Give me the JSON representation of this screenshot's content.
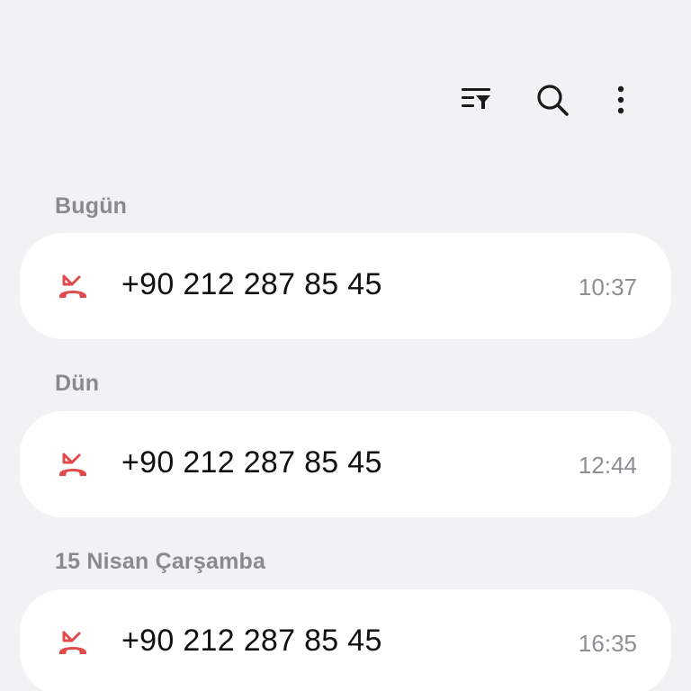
{
  "toolbar": {
    "filter_icon": "filter-list-icon",
    "search_icon": "search-icon",
    "more_icon": "more-vertical-icon"
  },
  "colors": {
    "missed": "#e04a4a",
    "background": "#f2f2f4",
    "card": "#ffffff",
    "header_text": "#8a8a8e",
    "time_text": "#8e8e93"
  },
  "groups": [
    {
      "header": "Bugün",
      "calls": [
        {
          "number": "+90 212 287 85 45",
          "time": "10:37",
          "type": "missed",
          "icon": "missed-call-icon"
        }
      ]
    },
    {
      "header": "Dün",
      "calls": [
        {
          "number": "+90 212 287 85 45",
          "time": "12:44",
          "type": "missed",
          "icon": "missed-call-icon"
        }
      ]
    },
    {
      "header": "15 Nisan Çarşamba",
      "calls": [
        {
          "number": "+90 212 287 85 45",
          "time": "16:35",
          "type": "missed",
          "icon": "missed-call-icon"
        }
      ]
    }
  ]
}
